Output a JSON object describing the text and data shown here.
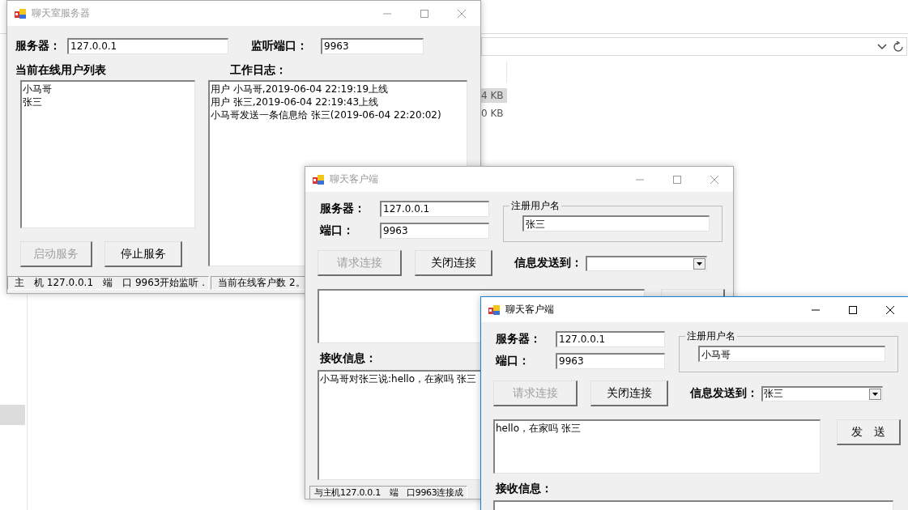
{
  "background_window": {
    "size_cells": [
      {
        "text": "4 KB",
        "selected": true
      },
      {
        "text": "0 KB",
        "selected": false
      }
    ]
  },
  "server_window": {
    "title": "聊天室服务器",
    "active": false,
    "server_label": "服务器：",
    "server_value": "127.0.0.1",
    "port_label": "监听端口：",
    "port_value": "9963",
    "users_heading": "当前在线用户列表",
    "users": [
      "小马哥",
      "张三"
    ],
    "log_heading": "工作日志：",
    "log": [
      "用户 小马哥,2019-06-04 22:19:19上线",
      "用户 张三,2019-06-04 22:19:43上线",
      "小马哥发送一条信息给 张三(2019-06-04 22:20:02)"
    ],
    "buttons": [
      {
        "label": "启动服务",
        "disabled": true
      },
      {
        "label": "停止服务",
        "disabled": false
      }
    ],
    "status_bar": [
      "主　机 127.0.0.1　端　口 9963开始监听 .",
      "当前在线客户数 2。"
    ]
  },
  "client_windows": [
    {
      "title": "聊天客户端",
      "active": false,
      "server_label": "服务器：",
      "server_value": "127.0.0.1",
      "port_label": "端口：",
      "port_value": "9963",
      "username_group": "注册用户名",
      "username_value": "张三",
      "buttons": [
        {
          "label": "请求连接",
          "disabled": true
        },
        {
          "label": "关闭连接",
          "disabled": false
        }
      ],
      "send_to_label": "信息发送到：",
      "receive_label": "接收信息：",
      "received": [
        "小马哥对张三说:hello，在家吗 张三"
      ],
      "status_bar": [
        "与主机127.0.0.1　端　口9963连接成"
      ]
    },
    {
      "title": "聊天客户端",
      "active": true,
      "server_label": "服务器：",
      "server_value": "127.0.0.1",
      "port_label": "端口：",
      "port_value": "9963",
      "username_group": "注册用户名",
      "username_value": "小马哥",
      "buttons": [
        {
          "label": "请求连接",
          "disabled": true
        },
        {
          "label": "关闭连接",
          "disabled": false
        }
      ],
      "send_to_label": "信息发送到：",
      "send_to_value": "张三",
      "message": "hello，在家吗 张三",
      "send_label": "发　送",
      "receive_label": "接收信息："
    }
  ]
}
